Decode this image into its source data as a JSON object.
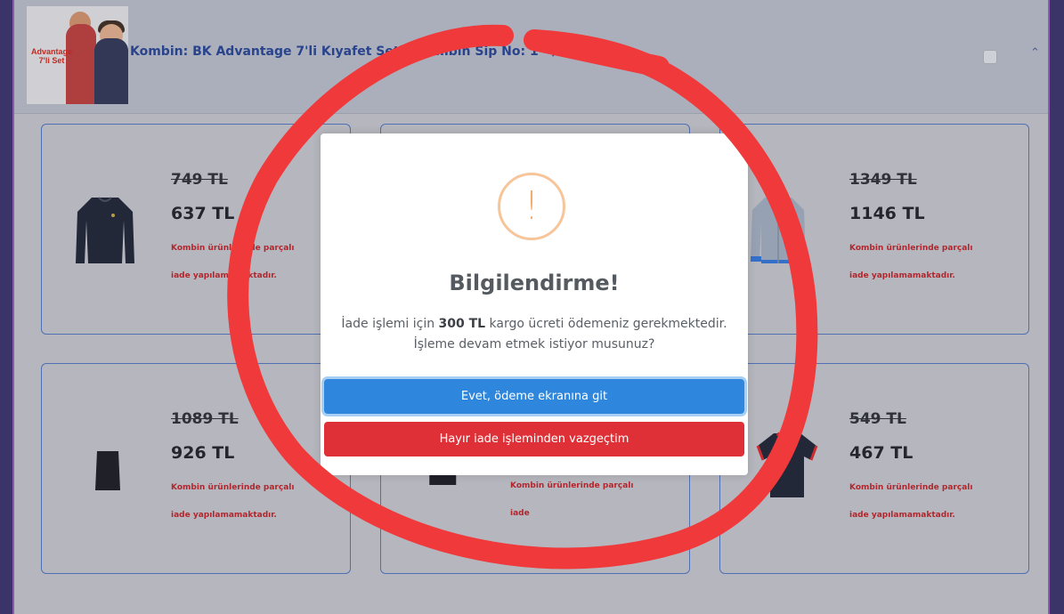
{
  "header": {
    "thumb_text": "Advantage 7'li Set",
    "title": "Kombin: BK Advantage 7'li Kıyafet Seti  - Kombin Sip No: 1   -  /80991",
    "chevron": "⌃"
  },
  "cards": [
    {
      "old_price": "749 TL",
      "new_price": "637 TL",
      "note": "Kombin ürünlerinde parçalı iade yapılamamaktadır.",
      "icon": "sweater-icon",
      "color": "#1d2233"
    },
    {
      "old_price": "1349 TL",
      "new_price": "1146 TL",
      "note": "Kombin ürünlerinde parçalı iade yapılamamaktadır.",
      "icon": "jacket-icon",
      "color": "#9aa6b8"
    },
    {
      "old_price": "1089 TL",
      "new_price": "926 TL",
      "note": "Kombin ürünlerinde parçalı iade yapılamamaktadır.",
      "icon": "skirt-icon",
      "color": "#1a1a22"
    },
    {
      "old_price": "",
      "new_price": "",
      "note": "Kombin ürünlerinde parçalı iade",
      "icon": "shorts-icon",
      "color": "#1a1a22"
    },
    {
      "old_price": "549 TL",
      "new_price": "467 TL",
      "note": "Kombin ürünlerinde parçalı iade yapılamamaktadır.",
      "icon": "polo-icon",
      "color": "#1d2233"
    }
  ],
  "modal": {
    "icon": "warning-icon",
    "title": "Bilgilendirme!",
    "text_before": "İade işlemi için ",
    "text_bold": "300 TL",
    "text_after": " kargo ücreti ödemeniz gerekmektedir. İşleme devam etmek istiyor musunuz?",
    "confirm_label": "Evet, ödeme ekranına git",
    "cancel_label": "Hayır iade işleminden vazgeçtim"
  },
  "colors": {
    "confirm": "#2f86dd",
    "cancel": "#de3036",
    "annotation": "#f0393a",
    "price_note": "#b72126"
  }
}
